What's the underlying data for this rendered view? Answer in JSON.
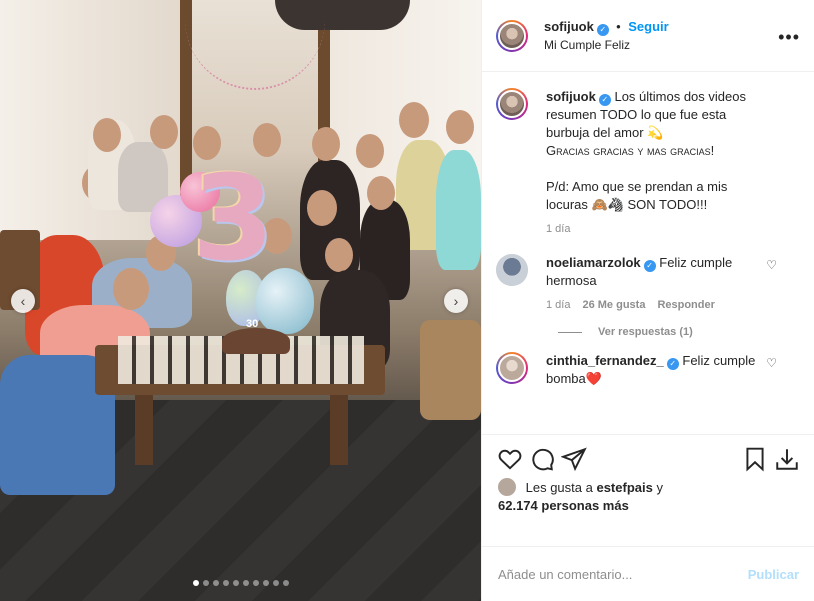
{
  "post": {
    "author": "sofijuok",
    "follow_label": "Seguir",
    "location": "Mi Cumple Feliz",
    "more_icon": "more-options-icon",
    "verified_icon": "verified-badge-icon"
  },
  "photo": {
    "balloon_number": "3",
    "cake_label": "30",
    "slide_count": 10,
    "active_slide": 1
  },
  "caption": {
    "username": "sofijuok",
    "lines": [
      "Los últimos dos videos",
      "resumen TODO lo que fue esta",
      "burbuja del amor 💫",
      "Gracias gracias y mas gracias!",
      "",
      "P/d: Amo que se prendan a mis",
      "locuras 🙈🦓 SON TODO!!!"
    ],
    "time": "1 día"
  },
  "comments": [
    {
      "username": "noeliamarzolok",
      "text": "Feliz cumple hermosa",
      "time": "1 día",
      "likes": "26 Me gusta",
      "reply_label": "Responder"
    },
    {
      "username": "cinthia_fernandez_",
      "text": "Feliz cumple bomba❤️"
    }
  ],
  "view_replies": "Ver respuestas (1)",
  "actions": {
    "like_icon": "heart-icon",
    "comment_icon": "comment-icon",
    "share_icon": "share-icon",
    "save_icon": "bookmark-icon",
    "download_icon": "download-icon"
  },
  "likes": {
    "prefix": "Les gusta a",
    "first_user": "estefpais",
    "connector": "y",
    "count_text": "62.174 personas más"
  },
  "add_comment": {
    "placeholder": "Añade un comentario...",
    "publish_label": "Publicar"
  }
}
